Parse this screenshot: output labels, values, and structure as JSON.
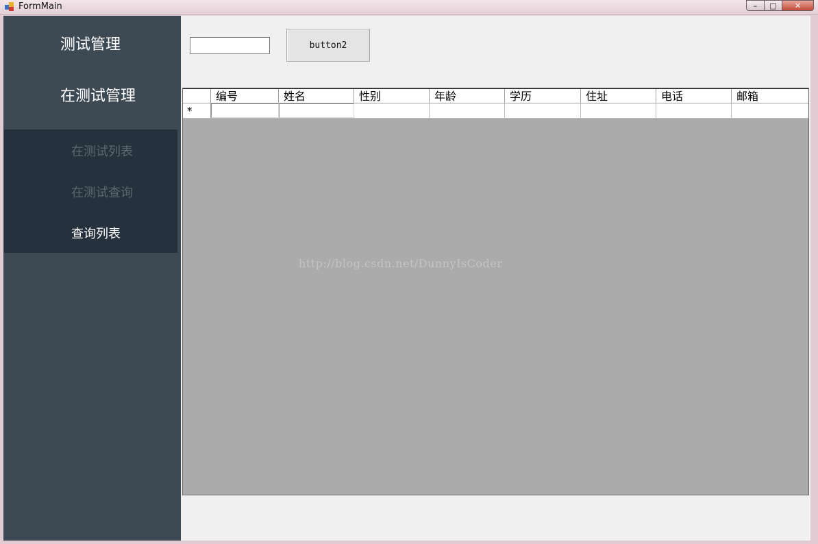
{
  "window": {
    "title": "FormMain",
    "controls": {
      "minimize": "–",
      "maximize": "□",
      "close": "✕"
    }
  },
  "sidebar": {
    "menu_top": "测试管理",
    "menu_sub": "在测试管理",
    "items": [
      {
        "label": "在测试列表",
        "state": "dim"
      },
      {
        "label": "在测试查询",
        "state": "dim"
      },
      {
        "label": "查询列表",
        "state": "active"
      }
    ]
  },
  "toolbar": {
    "textbox_value": "",
    "button2_label": "button2"
  },
  "grid": {
    "columns": [
      "编号",
      "姓名",
      "性别",
      "年龄",
      "学历",
      "住址",
      "电话",
      "邮箱"
    ],
    "new_row_marker": "*",
    "rows": []
  },
  "watermark": "http://blog.csdn.net/DunnyIsCoder",
  "colors": {
    "sidebar_bg": "#3d4a54",
    "submenu_bg": "#25313c",
    "grid_bg": "#ababab"
  }
}
